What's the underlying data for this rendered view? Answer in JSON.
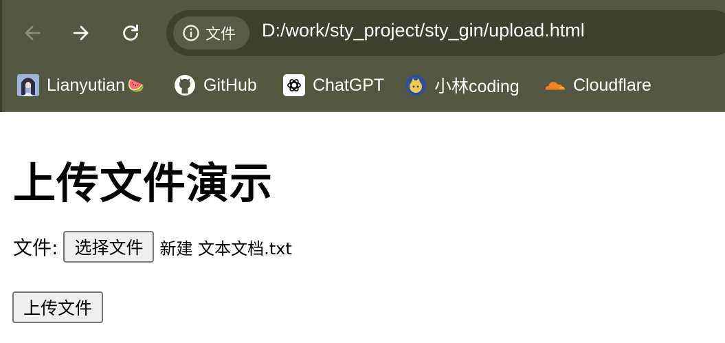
{
  "browser": {
    "site_chip_label": "文件",
    "url": "D:/work/sty_project/sty_gin/upload.html",
    "icons": {
      "back": "arrow-left-icon",
      "forward": "arrow-right-icon",
      "reload": "reload-icon",
      "site_info": "info-icon"
    }
  },
  "bookmarks": [
    {
      "label": "Lianyutian",
      "suffix": "🍉",
      "icon": "avatar-icon"
    },
    {
      "label": "GitHub",
      "icon": "github-icon"
    },
    {
      "label": "ChatGPT",
      "icon": "chatgpt-icon"
    },
    {
      "label": "小林coding",
      "icon": "xiaolin-icon"
    },
    {
      "label": "Cloudflare",
      "icon": "cloudflare-icon"
    }
  ],
  "page": {
    "title": "上传文件演示",
    "file_label": "文件:",
    "choose_button_label": "选择文件",
    "selected_file_name": "新建 文本文档.txt",
    "upload_button_label": "上传文件"
  },
  "colors": {
    "chrome_background": "#555840",
    "omnibox_background": "#3f4130",
    "site_chip_background": "#585b45",
    "button_background": "#efefef",
    "cloudflare_orange": "#f38020"
  }
}
